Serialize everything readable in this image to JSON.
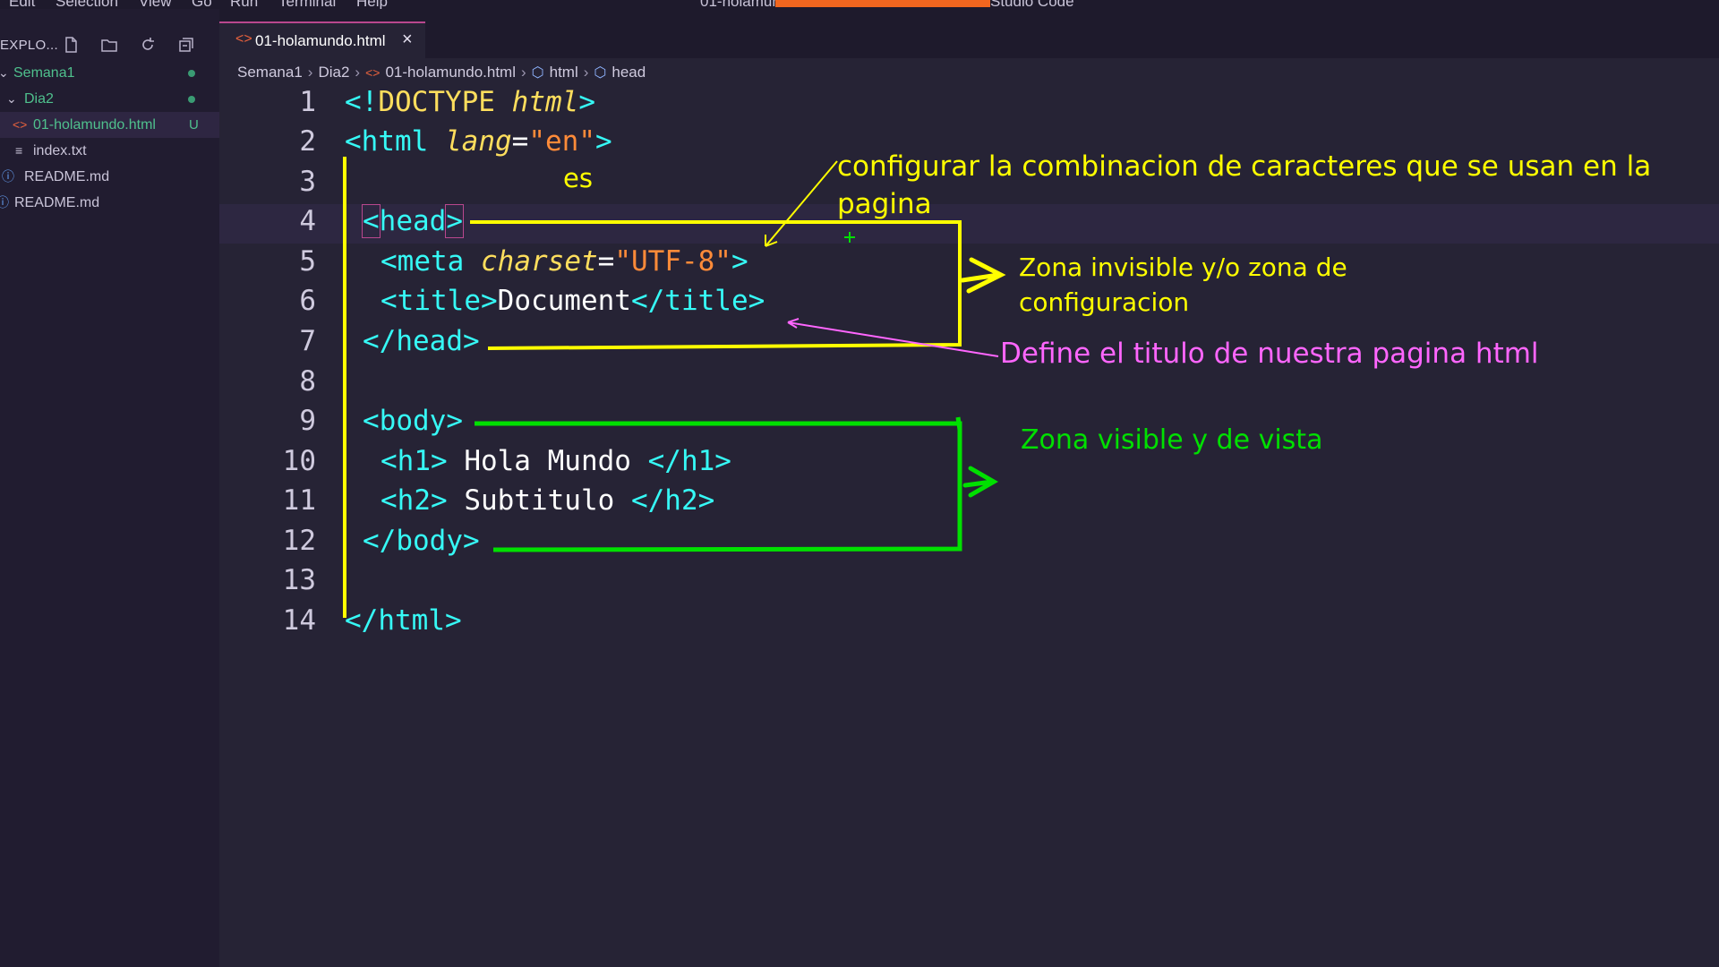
{
  "menubar": {
    "items": [
      "Edit",
      "Selection",
      "View",
      "Go",
      "Run",
      "Terminal",
      "Help"
    ],
    "window_title_start": "01-holamun",
    "window_title_end": "Studio Code"
  },
  "sidebar": {
    "title": "EXPLO...",
    "actions": [
      "new-file-icon",
      "new-folder-icon",
      "refresh-icon",
      "collapse-all-icon"
    ],
    "tree": [
      {
        "label": "Semana1",
        "status": "modified-dot"
      },
      {
        "label": "Dia2",
        "status": "modified-dot"
      },
      {
        "label": "01-holamundo.html",
        "badge": "U"
      },
      {
        "label": "index.txt"
      },
      {
        "label": "README.md"
      },
      {
        "label": "README.md"
      }
    ]
  },
  "tab": {
    "label": "01-holamundo.html",
    "close": "×"
  },
  "breadcrumb": {
    "items": [
      "Semana1",
      "Dia2",
      "01-holamundo.html",
      "html",
      "head"
    ],
    "sep": "›"
  },
  "editor": {
    "line_numbers": [
      "1",
      "2",
      "3",
      "4",
      "5",
      "6",
      "7",
      "8",
      "9",
      "10",
      "11",
      "12",
      "13",
      "14"
    ],
    "code": {
      "l1_open": "<!",
      "l1_doctype": "DOCTYPE",
      "l1_html": "html",
      "l1_close": ">",
      "l2_open": "<html",
      "l2_attr": "lang",
      "l2_eq": "=",
      "l2_val": "\"en\"",
      "l2_close": ">",
      "l4_lt": "<",
      "l4_head": "head",
      "l4_gt": ">",
      "l5_open": "<meta",
      "l5_attr": "charset",
      "l5_eq": "=",
      "l5_val": "\"UTF-8\"",
      "l5_close": ">",
      "l6_open": "<title>",
      "l6_text": "Document",
      "l6_close": "</title>",
      "l7": "</head>",
      "l9": "<body>",
      "l10_open": "<h1>",
      "l10_text": " Hola Mundo ",
      "l10_close": "</h1>",
      "l11_open": "<h2>",
      "l11_text": " Subtitulo ",
      "l11_close": "</h2>",
      "l12": "</body>",
      "l14": "</html>"
    }
  },
  "annotations": {
    "es_note": "es",
    "charset_note_1": "configurar la combinacion de caracteres que se usan en la",
    "charset_note_2": "pagina",
    "head_zone_1": "Zona invisible y/o zona de",
    "head_zone_2": "configuracion",
    "title_note": "Define el titulo de nuestra pagina html",
    "body_zone": "Zona visible y de vista"
  },
  "colors": {
    "background": "#262335",
    "sidebar": "#211c30",
    "tag": "#36f9f6",
    "attribute": "#fede5d",
    "string": "#ff8b39",
    "annotation_yellow": "#ffff00",
    "annotation_green": "#00e000",
    "annotation_pink": "#ff66ff"
  }
}
